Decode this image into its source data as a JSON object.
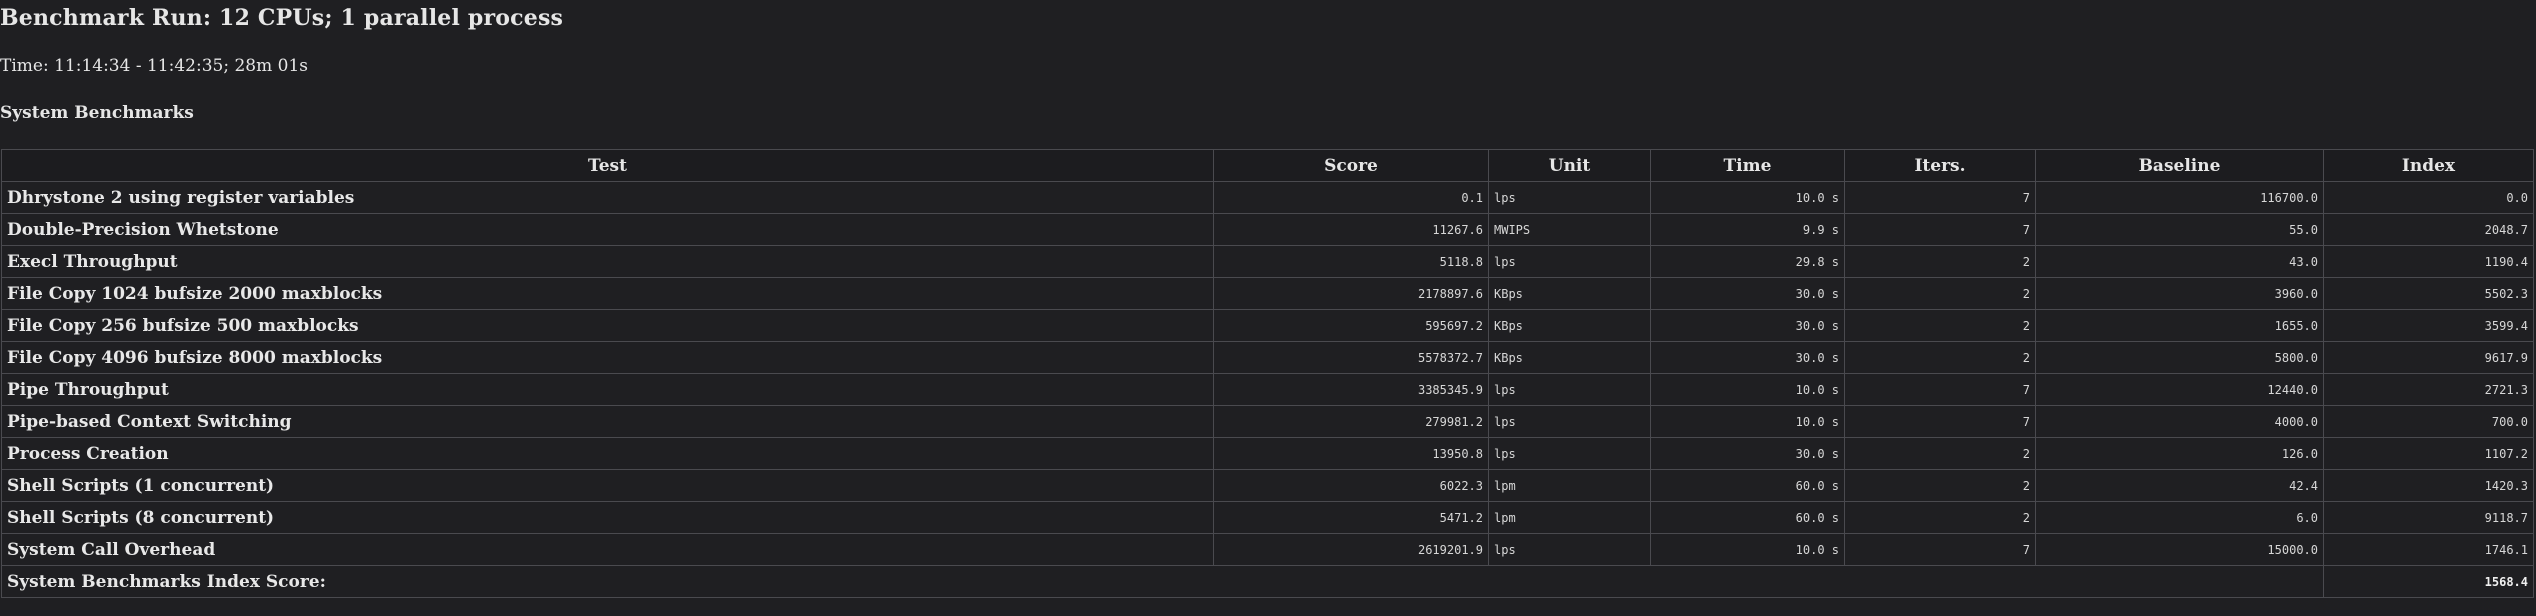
{
  "report": {
    "title": "Benchmark Run: 12 CPUs; 1 parallel process",
    "time": "Time: 11:14:34 - 11:42:35; 28m 01s",
    "section": "System Benchmarks"
  },
  "table": {
    "headers": [
      "Test",
      "Score",
      "Unit",
      "Time",
      "Iters.",
      "Baseline",
      "Index"
    ],
    "rows": [
      {
        "test": "Dhrystone 2 using register variables",
        "score": "0.1",
        "unit": "lps",
        "time": "10.0 s",
        "iters": "7",
        "baseline": "116700.0",
        "index": "0.0"
      },
      {
        "test": "Double-Precision Whetstone",
        "score": "11267.6",
        "unit": "MWIPS",
        "time": "9.9 s",
        "iters": "7",
        "baseline": "55.0",
        "index": "2048.7"
      },
      {
        "test": "Execl Throughput",
        "score": "5118.8",
        "unit": "lps",
        "time": "29.8 s",
        "iters": "2",
        "baseline": "43.0",
        "index": "1190.4"
      },
      {
        "test": "File Copy 1024 bufsize 2000 maxblocks",
        "score": "2178897.6",
        "unit": "KBps",
        "time": "30.0 s",
        "iters": "2",
        "baseline": "3960.0",
        "index": "5502.3"
      },
      {
        "test": "File Copy 256 bufsize 500 maxblocks",
        "score": "595697.2",
        "unit": "KBps",
        "time": "30.0 s",
        "iters": "2",
        "baseline": "1655.0",
        "index": "3599.4"
      },
      {
        "test": "File Copy 4096 bufsize 8000 maxblocks",
        "score": "5578372.7",
        "unit": "KBps",
        "time": "30.0 s",
        "iters": "2",
        "baseline": "5800.0",
        "index": "9617.9"
      },
      {
        "test": "Pipe Throughput",
        "score": "3385345.9",
        "unit": "lps",
        "time": "10.0 s",
        "iters": "7",
        "baseline": "12440.0",
        "index": "2721.3"
      },
      {
        "test": "Pipe-based Context Switching",
        "score": "279981.2",
        "unit": "lps",
        "time": "10.0 s",
        "iters": "7",
        "baseline": "4000.0",
        "index": "700.0"
      },
      {
        "test": "Process Creation",
        "score": "13950.8",
        "unit": "lps",
        "time": "30.0 s",
        "iters": "2",
        "baseline": "126.0",
        "index": "1107.2"
      },
      {
        "test": "Shell Scripts (1 concurrent)",
        "score": "6022.3",
        "unit": "lpm",
        "time": "60.0 s",
        "iters": "2",
        "baseline": "42.4",
        "index": "1420.3"
      },
      {
        "test": "Shell Scripts (8 concurrent)",
        "score": "5471.2",
        "unit": "lpm",
        "time": "60.0 s",
        "iters": "2",
        "baseline": "6.0",
        "index": "9118.7"
      },
      {
        "test": "System Call Overhead",
        "score": "2619201.9",
        "unit": "lps",
        "time": "10.0 s",
        "iters": "7",
        "baseline": "15000.0",
        "index": "1746.1"
      }
    ],
    "summary": {
      "label": "System Benchmarks Index Score:",
      "value": "1568.4"
    }
  }
}
